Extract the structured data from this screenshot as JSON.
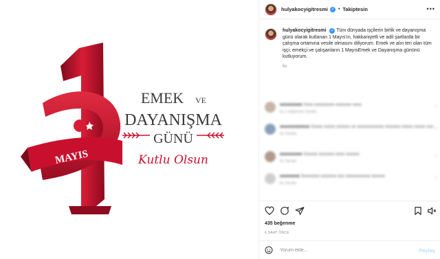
{
  "post_image": {
    "big_number": "1",
    "banner_text": "MAYIS",
    "headline_line1": "EMEK",
    "headline_line1_small": "VE",
    "headline_line2": "DAYANIŞMA",
    "headline_line3": "GÜNÜ",
    "script_text": "Kutlu Olsun",
    "colors": {
      "red": "#c8102e",
      "dark_red": "#8e0b1f",
      "text_dark": "#3a3a3a"
    }
  },
  "header": {
    "username": "hulyakocyigitresmi",
    "separator": "•",
    "follow_label": "Takiptesin",
    "more_label": "•••"
  },
  "caption": {
    "username": "hulyakocyigitresmi",
    "text": "Tüm dünyada işçilerin birlik ve dayanışma günü olarak kutlanan 1 Mayıs'ın, hakkaniyetli ve adil şartlarda bir çalışma ortamına vesile olmasını diliyorum. Emek ve alın teri olan tüm işçi, emekçi ve çalışanların 1 MayısEmek ve Dayanışma gününü kutluyorum.",
    "time": "6s"
  },
  "comments": [
    {
      "user": "xxxxxxxxx",
      "text": "Xxxx xxxxxxxxx xxxxxxx xxxx",
      "meta": "6s  1 beğenme  Yanıtla"
    },
    {
      "user": "xxxxxxxxxxxx",
      "text": "Xxxxx xxxxx xxxxxx xx xxxxxxxxxxxx xxxxxxx xxxxx xxxxx xxx",
      "meta": "6s  Yanıtla"
    },
    {
      "user": "xxxxxxxxx",
      "text": "Xxxxxx xxxxxxx xxxx xxxxxx",
      "meta": "6s  Yanıtla"
    },
    {
      "user": "xxxxxxxx",
      "text": "Xxxxxxxx xxxxxxx xxx xxxxxxxxxxx xxxxxx",
      "meta": "6s  Yanıtla"
    }
  ],
  "likes_text": "435 beğenme",
  "post_time": "6 SAAT ÖNCE",
  "comment_box": {
    "placeholder": "Yorum ekle...",
    "share_label": "Paylaş"
  }
}
